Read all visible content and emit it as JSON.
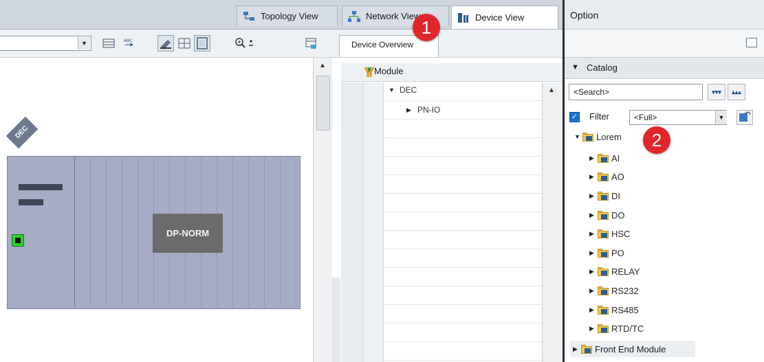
{
  "tabs": {
    "topology": "Topology View",
    "network": "Network View",
    "device": "Device View"
  },
  "overview": {
    "tab_label": "Device Overview",
    "column_header": "Module",
    "rows": [
      {
        "label": "DEC",
        "expanded": true
      },
      {
        "label": "PN-IO",
        "expanded": false
      }
    ]
  },
  "canvas": {
    "device_tag": "DEC",
    "module_box": "DP-NORM"
  },
  "options": {
    "title": "Option",
    "catalog_label": "Catalog",
    "search_placeholder": "<Search>",
    "filter_label": "Filter",
    "filter_value": "<Full>",
    "filter_checked": true,
    "root_folder": "Lorem",
    "folders": [
      "AI",
      "AO",
      "DI",
      "DO",
      "HSC",
      "PO",
      "RELAY",
      "RS232",
      "RS485",
      "RTD/TC"
    ],
    "bottom_folder": "Front End Module"
  },
  "badges": [
    "1",
    "2"
  ],
  "colors": {
    "badge": "#e0262b",
    "device_body": "#a7acc6",
    "module_box": "#6b6b6b",
    "port": "#2bd02b"
  }
}
